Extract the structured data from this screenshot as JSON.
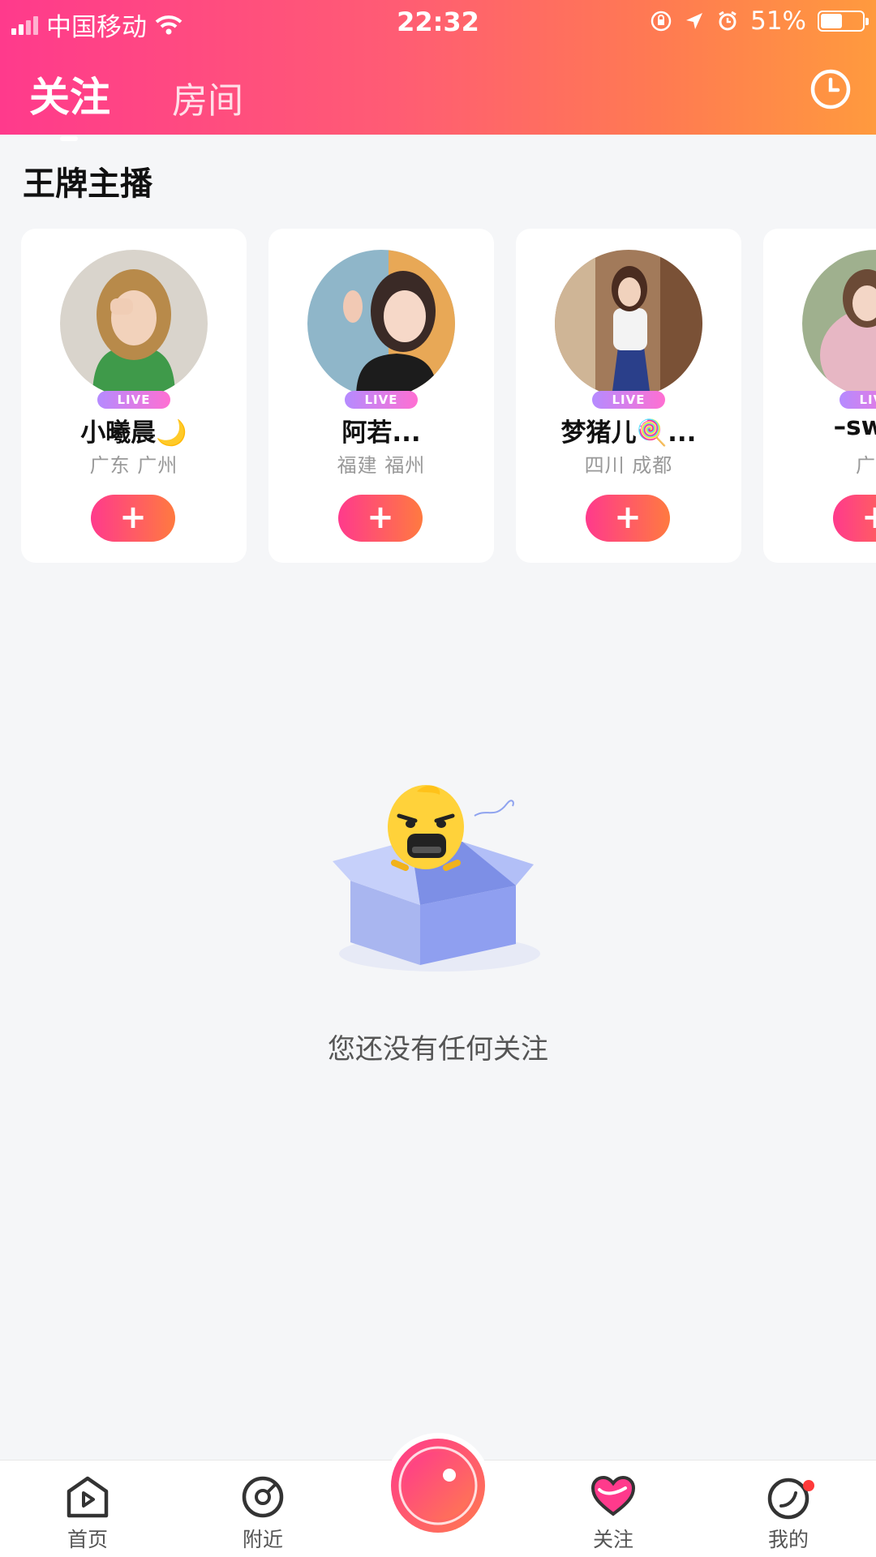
{
  "status_bar": {
    "carrier": "中国移动",
    "time": "22:32",
    "battery": "51%",
    "battery_level": 0.51
  },
  "header": {
    "tabs": [
      {
        "label": "关注",
        "active": true
      },
      {
        "label": "房间",
        "active": false
      }
    ],
    "history_icon": "clock-icon"
  },
  "section": {
    "title": "王牌主播",
    "anchors": [
      {
        "name": "小曦晨🌙",
        "location": "广东 广州",
        "badge": "LIVE",
        "button": "+"
      },
      {
        "name": "阿若...",
        "location": "福建 福州",
        "badge": "LIVE",
        "button": "+"
      },
      {
        "name": "梦猪儿🍭...",
        "location": "四川 成都",
        "badge": "LIVE",
        "button": "+"
      },
      {
        "name": "–swee",
        "location": "广东",
        "badge": "LIVE",
        "button": "+"
      }
    ]
  },
  "empty_state": {
    "message": "您还没有任何关注"
  },
  "bottom_nav": {
    "items": [
      {
        "label": "首页",
        "icon": "home-play-icon"
      },
      {
        "label": "附近",
        "icon": "nearby-icon"
      },
      {
        "label": "",
        "icon": "record-button-icon"
      },
      {
        "label": "关注",
        "icon": "heart-icon"
      },
      {
        "label": "我的",
        "icon": "profile-icon"
      }
    ]
  },
  "colors": {
    "header_start": "#ff3a8c",
    "header_end": "#ff9a3e",
    "accent": "#ff3a8c",
    "background": "#f5f6f8"
  }
}
